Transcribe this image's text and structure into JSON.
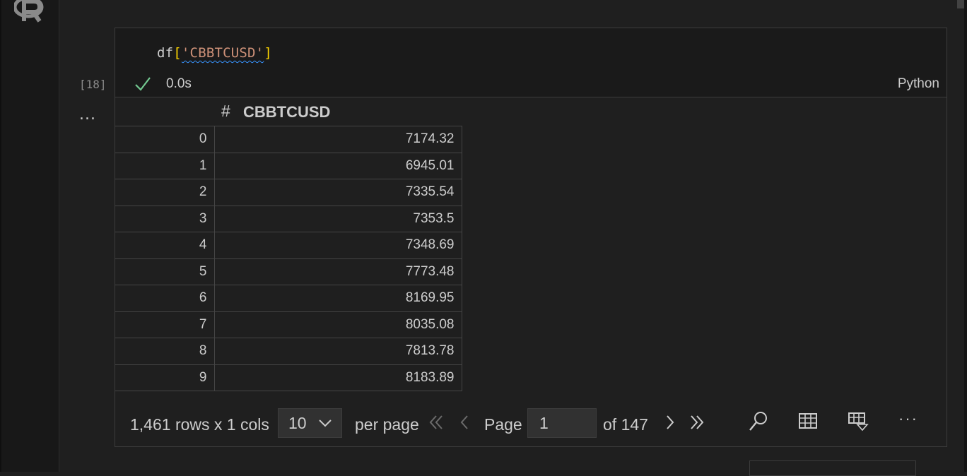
{
  "cell": {
    "code": {
      "var": "df",
      "open": "[",
      "str": "'CBBTCUSD'",
      "close": "]"
    },
    "exec_count": "[18]",
    "exec_time": "0.0s",
    "language": "Python",
    "output_more": "..."
  },
  "grid": {
    "column_type_icon": "#",
    "column": "CBBTCUSD",
    "rows": [
      {
        "idx": "0",
        "val": "7174.32"
      },
      {
        "idx": "1",
        "val": "6945.01"
      },
      {
        "idx": "2",
        "val": "7335.54"
      },
      {
        "idx": "3",
        "val": "7353.5"
      },
      {
        "idx": "4",
        "val": "7348.69"
      },
      {
        "idx": "5",
        "val": "7773.48"
      },
      {
        "idx": "6",
        "val": "8169.95"
      },
      {
        "idx": "7",
        "val": "8035.08"
      },
      {
        "idx": "8",
        "val": "7813.78"
      },
      {
        "idx": "9",
        "val": "8183.89"
      }
    ]
  },
  "pager": {
    "rows_info": "1,461 rows x 1 cols",
    "page_size": "10",
    "per_page": "per page",
    "page_label": "Page",
    "current_page": "1",
    "of_total": "of 147",
    "more": "···"
  },
  "icons": {
    "logo": "r-logo",
    "check": "check-icon",
    "first": "double-chevron-left-icon",
    "prev": "chevron-left-icon",
    "next": "chevron-right-icon",
    "last": "double-chevron-right-icon",
    "search": "search-icon",
    "table": "table-icon",
    "filter": "filter-icon"
  },
  "colors": {
    "check": "#73c991",
    "string": "#ce9178",
    "bracket": "#ffd700",
    "squiggle": "#3794ff"
  }
}
